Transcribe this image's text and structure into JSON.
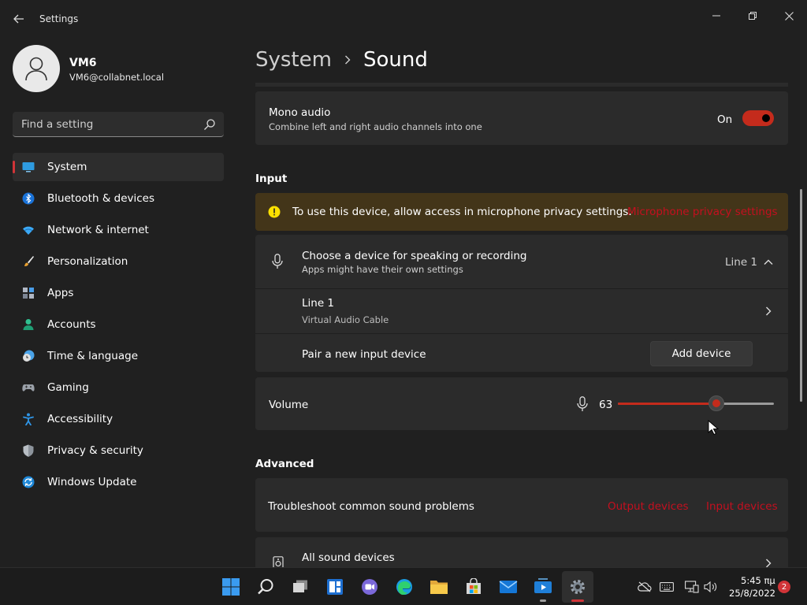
{
  "window": {
    "title": "Settings"
  },
  "user": {
    "name": "VM6",
    "email": "VM6@collabnet.local"
  },
  "search": {
    "placeholder": "Find a setting"
  },
  "sidebar": {
    "items": [
      {
        "label": "System",
        "icon": "system-icon",
        "active": true
      },
      {
        "label": "Bluetooth & devices",
        "icon": "bluetooth-icon"
      },
      {
        "label": "Network & internet",
        "icon": "wifi-icon"
      },
      {
        "label": "Personalization",
        "icon": "brush-icon"
      },
      {
        "label": "Apps",
        "icon": "apps-icon"
      },
      {
        "label": "Accounts",
        "icon": "person-icon"
      },
      {
        "label": "Time & language",
        "icon": "clock-globe-icon"
      },
      {
        "label": "Gaming",
        "icon": "gamepad-icon"
      },
      {
        "label": "Accessibility",
        "icon": "accessibility-icon"
      },
      {
        "label": "Privacy & security",
        "icon": "shield-icon"
      },
      {
        "label": "Windows Update",
        "icon": "update-icon"
      }
    ]
  },
  "breadcrumb": {
    "parent": "System",
    "current": "Sound"
  },
  "mono_audio": {
    "title": "Mono audio",
    "subtitle": "Combine left and right audio channels into one",
    "state_label": "On",
    "enabled": true
  },
  "input": {
    "heading": "Input",
    "warning_text": "To use this device, allow access in microphone privacy settings.",
    "warning_link": "Microphone privacy settings",
    "choose_title": "Choose a device for speaking or recording",
    "choose_subtitle": "Apps might have their own settings",
    "selected_device": "Line 1",
    "device_name": "Line 1",
    "device_sub": "Virtual Audio Cable",
    "pair_label": "Pair a new input device",
    "add_button": "Add device",
    "volume_label": "Volume",
    "volume_value": "63",
    "volume_fraction": 0.63
  },
  "advanced": {
    "heading": "Advanced",
    "troubleshoot_label": "Troubleshoot common sound problems",
    "output_link": "Output devices",
    "input_link": "Input devices",
    "all_devices_label": "All sound devices"
  },
  "taskbar": {
    "apps": [
      "start-icon",
      "search-icon",
      "task-view-icon",
      "widgets-icon",
      "chat-icon",
      "edge-icon",
      "file-explorer-icon",
      "store-icon",
      "mail-icon",
      "media-player-icon",
      "settings-gear-icon"
    ],
    "time": "5:45 πμ",
    "date": "25/8/2022",
    "notifications": "2"
  },
  "colors": {
    "accent": "#c42b1c",
    "warning_bg": "#433519",
    "card_bg": "#2b2b2b"
  }
}
